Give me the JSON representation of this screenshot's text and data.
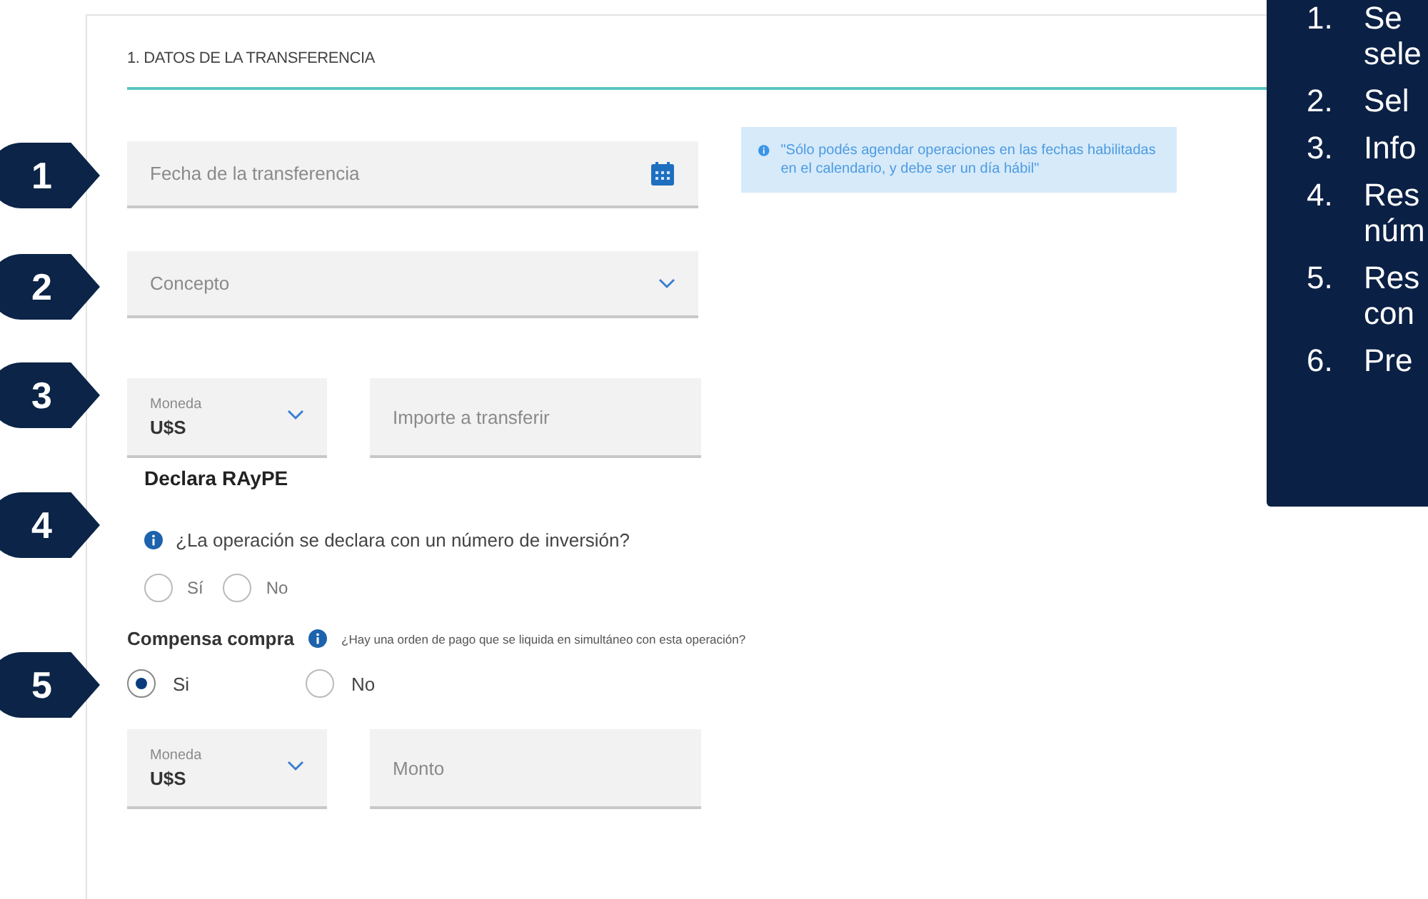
{
  "section_title": "1. DATOS DE LA TRANSFERENCIA",
  "date_field": {
    "placeholder": "Fecha de la transferencia"
  },
  "date_info": "\"Sólo podés agendar operaciones en las fechas habilitadas en el calendario, y debe ser un día hábil\"",
  "concept_select": {
    "placeholder": "Concepto"
  },
  "currency_select": {
    "label": "Moneda",
    "value": "U$S"
  },
  "amount_field": {
    "placeholder": "Importe a transferir"
  },
  "raype": {
    "title": "Declara RAyPE",
    "question": "¿La operación se declara con un número de inversión?",
    "options": [
      {
        "label": "Sí",
        "selected": false
      },
      {
        "label": "No",
        "selected": false
      }
    ]
  },
  "compensa": {
    "title": "Compensa compra",
    "question": "¿Hay una orden de pago que se liquida en simultáneo con esta operación?",
    "options": [
      {
        "label": "Si",
        "selected": true
      },
      {
        "label": "No",
        "selected": false
      }
    ]
  },
  "compensa_currency_select": {
    "label": "Moneda",
    "value": "U$S"
  },
  "compensa_amount_field": {
    "placeholder": "Monto"
  },
  "markers": [
    "1",
    "2",
    "3",
    "4",
    "5"
  ],
  "steps_panel": [
    {
      "number": "1.",
      "lines": [
        "Se",
        "sele"
      ]
    },
    {
      "number": "2.",
      "lines": [
        "Sel"
      ]
    },
    {
      "number": "3.",
      "lines": [
        "Info"
      ]
    },
    {
      "number": "4.",
      "lines": [
        "Res",
        "núm"
      ]
    },
    {
      "number": "5.",
      "lines": [
        "Res",
        "con"
      ]
    },
    {
      "number": "6.",
      "lines": [
        "Pre"
      ]
    }
  ]
}
